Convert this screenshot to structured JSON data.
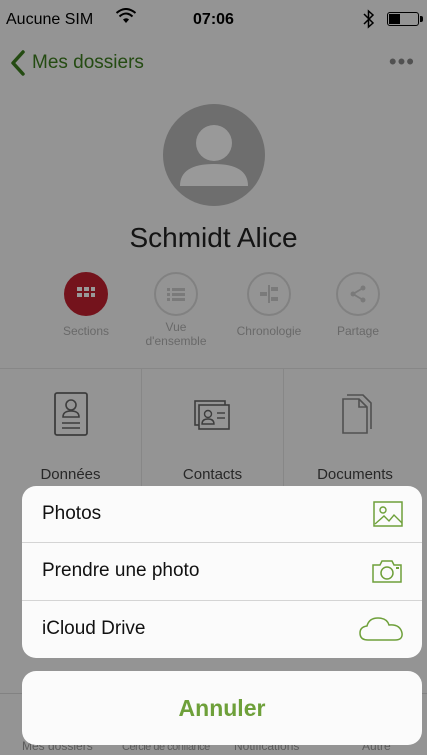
{
  "status_bar": {
    "carrier": "Aucune SIM",
    "time": "07:06"
  },
  "nav": {
    "back_label": "Mes dossiers",
    "more_label": "•••"
  },
  "profile": {
    "name": "Schmidt Alice"
  },
  "tabs": [
    {
      "label": "Sections",
      "icon": "grid-icon",
      "active": true
    },
    {
      "label": "Vue\nd'ensemble",
      "icon": "list-icon",
      "active": false
    },
    {
      "label": "Chronologie",
      "icon": "timeline-icon",
      "active": false
    },
    {
      "label": "Partage",
      "icon": "share-icon",
      "active": false
    }
  ],
  "grid": [
    {
      "label": "Données personnelles",
      "icon": "id-card-icon"
    },
    {
      "label": "Contacts",
      "icon": "contacts-icon"
    },
    {
      "label": "Documents",
      "icon": "documents-icon"
    }
  ],
  "bottom_bar": {
    "items": [
      "Mes dossiers",
      "Cercle de confiance",
      "Notifications",
      "Autre"
    ]
  },
  "action_sheet": {
    "options": [
      {
        "label": "Photos",
        "icon": "image-icon"
      },
      {
        "label": "Prendre une photo",
        "icon": "camera-icon"
      },
      {
        "label": "iCloud Drive",
        "icon": "cloud-icon"
      }
    ],
    "cancel_label": "Annuler"
  },
  "colors": {
    "brand_green": "#6ea03a",
    "active_red": "#c2212f"
  }
}
